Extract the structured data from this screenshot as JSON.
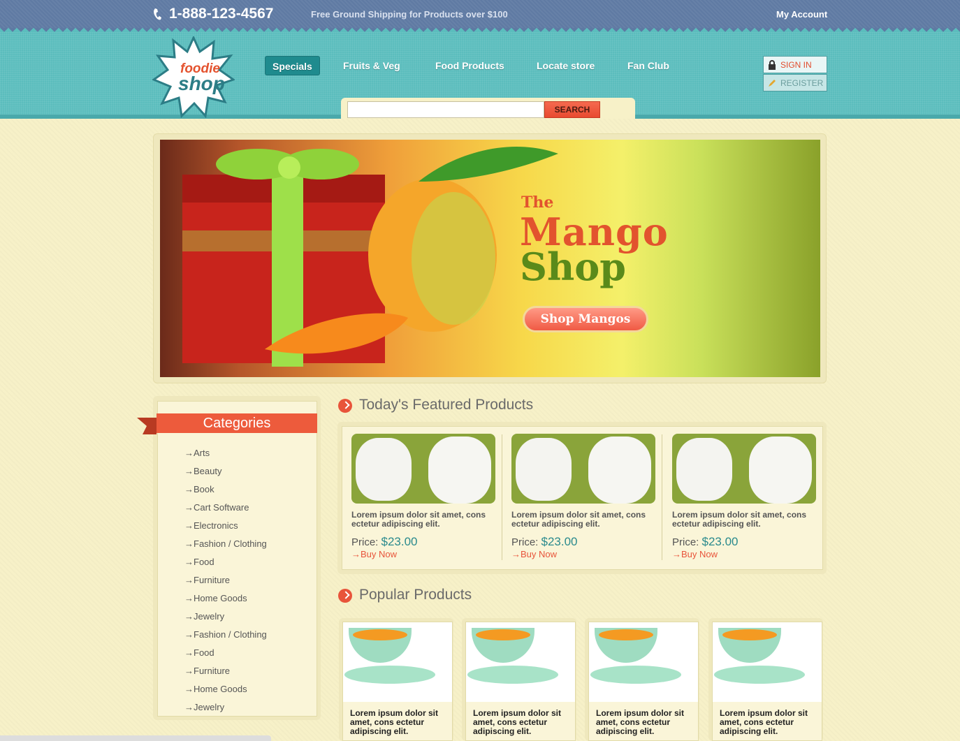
{
  "topbar": {
    "phone": "1-888-123-4567",
    "shipping": "Free Ground Shipping for Products over $100",
    "account": "My Account"
  },
  "logo": {
    "line1": "foodie",
    "line2": "shop"
  },
  "nav": {
    "items": [
      {
        "label": "Specials",
        "active": true
      },
      {
        "label": "Fruits & Veg",
        "active": false
      },
      {
        "label": "Food Products",
        "active": false
      },
      {
        "label": "Locate store",
        "active": false
      },
      {
        "label": "Fan Club",
        "active": false
      }
    ]
  },
  "auth": {
    "signin": "SIGN IN",
    "register": "REGISTER"
  },
  "search": {
    "value": "",
    "button": "SEARCH"
  },
  "banner": {
    "the": "The",
    "mango": "Mango",
    "shop": "Shop",
    "button": "Shop Mangos"
  },
  "categories": {
    "title": "Categories",
    "items": [
      "→Arts",
      "→Beauty",
      "→Book",
      "→Cart Software",
      "→Electronics",
      "→Fashion / Clothing",
      "→Food",
      "→Furniture",
      "→Home Goods",
      "→Jewelry",
      "→Fashion / Clothing",
      "→Food",
      "→Furniture",
      "→Home Goods",
      "→Jewelry"
    ]
  },
  "featured": {
    "title": "Today's Featured Products",
    "products": [
      {
        "desc": "Lorem ipsum dolor sit amet, cons ectetur adipiscing elit.",
        "price_label": "Price:",
        "price": "$23.00",
        "buy": "→Buy Now"
      },
      {
        "desc": "Lorem ipsum dolor sit amet, cons ectetur adipiscing elit.",
        "price_label": "Price:",
        "price": "$23.00",
        "buy": "→Buy Now"
      },
      {
        "desc": "Lorem ipsum dolor sit amet, cons ectetur adipiscing elit.",
        "price_label": "Price:",
        "price": "$23.00",
        "buy": "→Buy Now"
      }
    ]
  },
  "popular": {
    "title": "Popular Products",
    "products": [
      {
        "desc": "Lorem ipsum dolor sit amet, cons ectetur adipiscing elit."
      },
      {
        "desc": "Lorem ipsum dolor sit amet, cons ectetur adipiscing elit."
      },
      {
        "desc": "Lorem ipsum dolor sit amet, cons ectetur adipiscing elit."
      },
      {
        "desc": "Lorem ipsum dolor sit amet, cons ectetur adipiscing elit."
      }
    ]
  },
  "colors": {
    "accent": "#e8543a",
    "teal": "#5bbdbd",
    "topbar": "#5f7aa3",
    "price": "#2a8a8d"
  }
}
